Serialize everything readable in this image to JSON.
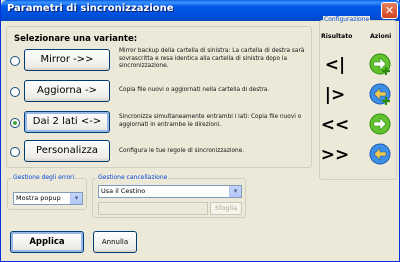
{
  "window": {
    "title": "Parametri di sincronizzazione",
    "close_glyph": "✕"
  },
  "main": {
    "heading": "Selezionare una variante:",
    "options": [
      {
        "label": "Mirror ->>",
        "selected": false,
        "description": "Mirror backup della cartella di sinistra: La cartella di destra sarà sovrascritta e resa identica alla cartella di sinistra dopo la sincronizzazione."
      },
      {
        "label": "Aggiorna ->",
        "selected": false,
        "description": "Copia file nuovi o aggiornati nella cartella di destra."
      },
      {
        "label": "Dai 2 lati <->",
        "selected": true,
        "description": "Sincronizza simultaneamente entrambi i lati: Copia file nuovi o aggiornati in entrambe le direzioni."
      },
      {
        "label": "Personalizza",
        "selected": false,
        "description": "Configura le tue regole di sincronizzazione."
      }
    ]
  },
  "config": {
    "legend": "Configurazione",
    "col_result": "Risultato",
    "col_actions": "Azioni",
    "rows": [
      {
        "symbol": "<|",
        "action_icon": "arrow-right-plus-icon"
      },
      {
        "symbol": "|>",
        "action_icon": "arrow-left-plus-icon"
      },
      {
        "symbol": "<<",
        "action_icon": "arrow-right-icon"
      },
      {
        "symbol": ">>",
        "action_icon": "arrow-left-icon"
      }
    ]
  },
  "errors": {
    "legend": "Gestione degli errori",
    "value": "Mostra popup"
  },
  "deletion": {
    "legend": "Gestione cancellazione",
    "value": "Usa il Cestino",
    "browse_label": "Sfoglia"
  },
  "buttons": {
    "apply": "Applica",
    "cancel": "Annulla"
  },
  "colors": {
    "title_bar": "#0054e3",
    "accent_green": "#3ca83c",
    "arrow_green": "#62c32c",
    "arrow_blue": "#3d8fe8"
  }
}
